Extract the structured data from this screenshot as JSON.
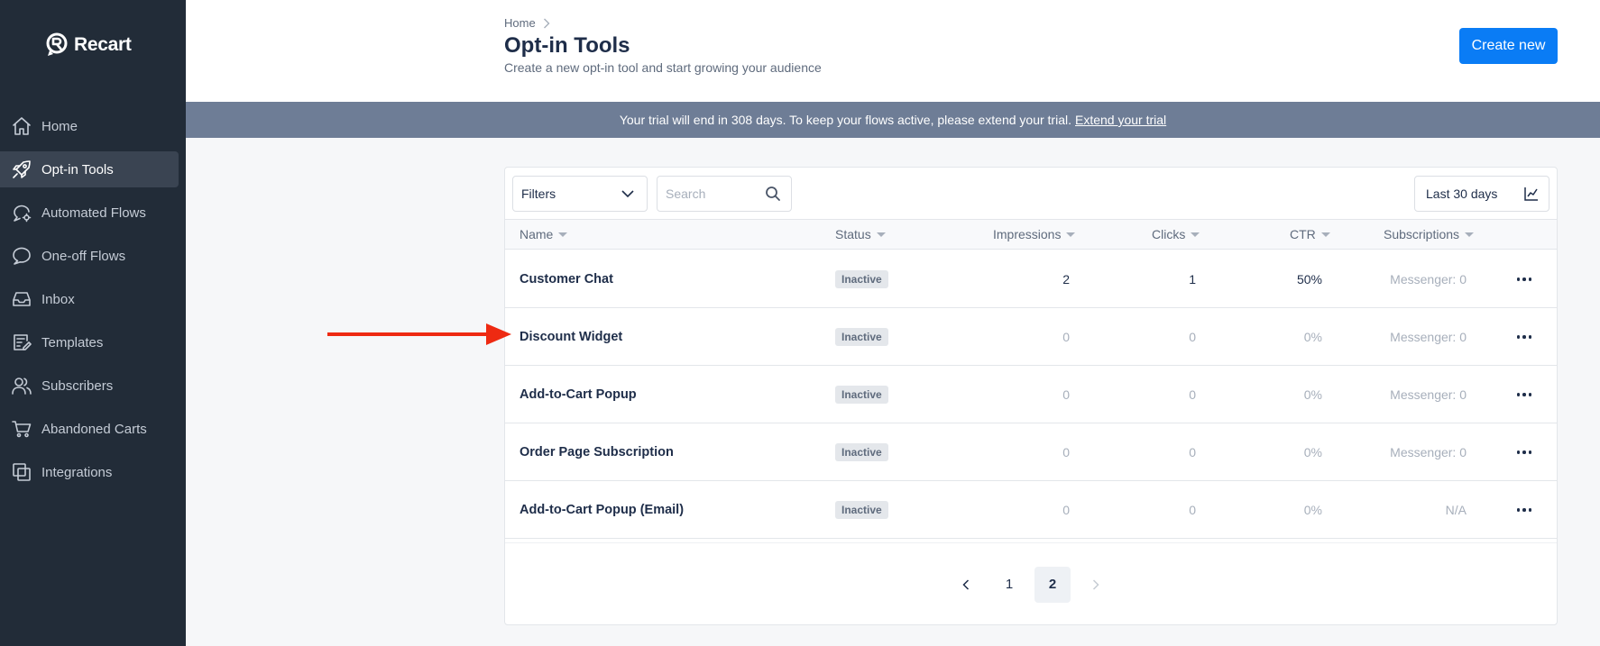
{
  "brand": {
    "name": "Recart"
  },
  "sidebar": {
    "items": [
      {
        "label": "Home",
        "icon": "home-icon",
        "active": false
      },
      {
        "label": "Opt-in Tools",
        "icon": "rocket-icon",
        "active": true
      },
      {
        "label": "Automated Flows",
        "icon": "chat-gear-icon",
        "active": false
      },
      {
        "label": "One-off Flows",
        "icon": "chat-icon",
        "active": false
      },
      {
        "label": "Inbox",
        "icon": "inbox-icon",
        "active": false
      },
      {
        "label": "Templates",
        "icon": "template-icon",
        "active": false
      },
      {
        "label": "Subscribers",
        "icon": "users-icon",
        "active": false
      },
      {
        "label": "Abandoned Carts",
        "icon": "cart-icon",
        "active": false
      },
      {
        "label": "Integrations",
        "icon": "layers-icon",
        "active": false
      }
    ]
  },
  "header": {
    "breadcrumb": "Home",
    "title": "Opt-in Tools",
    "subtitle": "Create a new opt-in tool and start growing your audience",
    "create_label": "Create new"
  },
  "banner": {
    "text": "Your trial will end in 308 days. To keep your flows active, please extend your trial.",
    "link": "Extend your trial"
  },
  "toolbar": {
    "filters_label": "Filters",
    "search_placeholder": "Search",
    "date_range": "Last 30 days"
  },
  "table": {
    "columns": [
      "Name",
      "Status",
      "Impressions",
      "Clicks",
      "CTR",
      "Subscriptions"
    ],
    "rows": [
      {
        "name": "Customer Chat",
        "status": "Inactive",
        "impressions": "2",
        "clicks": "1",
        "ctr": "50%",
        "subscriptions": "Messenger: 0"
      },
      {
        "name": "Discount Widget",
        "status": "Inactive",
        "impressions": "0",
        "clicks": "0",
        "ctr": "0%",
        "subscriptions": "Messenger: 0"
      },
      {
        "name": "Add-to-Cart Popup",
        "status": "Inactive",
        "impressions": "0",
        "clicks": "0",
        "ctr": "0%",
        "subscriptions": "Messenger: 0"
      },
      {
        "name": "Order Page Subscription",
        "status": "Inactive",
        "impressions": "0",
        "clicks": "0",
        "ctr": "0%",
        "subscriptions": "Messenger: 0"
      },
      {
        "name": "Add-to-Cart Popup (Email)",
        "status": "Inactive",
        "impressions": "0",
        "clicks": "0",
        "ctr": "0%",
        "subscriptions": "N/A"
      }
    ]
  },
  "pagination": {
    "pages": [
      "1",
      "2"
    ],
    "current": "2"
  },
  "colors": {
    "sidebar": "#222c38",
    "accent": "#0a7cf5",
    "banner": "#6e7d96",
    "annotation": "#ee2a12"
  }
}
